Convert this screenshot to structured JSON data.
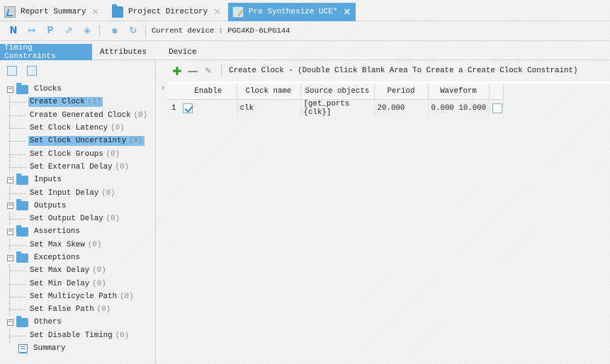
{
  "doc_tabs": [
    {
      "label": "Report Summary",
      "icon": "report-icon",
      "active": false
    },
    {
      "label": "Project Directory",
      "icon": "folder-icon",
      "active": false
    },
    {
      "label": "Pre Synthesize UCE*",
      "icon": "document-icon",
      "active": true
    }
  ],
  "toolbar": {
    "buttons": [
      {
        "glyph": "N",
        "icon": "new-icon"
      },
      {
        "glyph": "↦",
        "icon": "arrow-icon"
      },
      {
        "glyph": "P",
        "icon": "p-icon"
      },
      {
        "glyph": "⬀",
        "icon": "cursor-icon"
      },
      {
        "glyph": "◈",
        "icon": "diamond-icon"
      },
      {
        "glyph": "▪",
        "icon": "save-icon"
      },
      {
        "glyph": "↻",
        "icon": "refresh-icon"
      }
    ],
    "current_device": "Current device : PGC4KD-6LPG144"
  },
  "panel_tabs": [
    "Timing Constraints",
    "Attributes",
    "Device"
  ],
  "tree": [
    {
      "type": "cat",
      "label": "Clocks"
    },
    {
      "type": "leaf",
      "label": "Create Clock",
      "count": "(1)",
      "selected": true
    },
    {
      "type": "leaf",
      "label": "Create Generated Clock",
      "count": "(0)"
    },
    {
      "type": "leaf",
      "label": "Set Clock Latency",
      "count": "(0)"
    },
    {
      "type": "leaf",
      "label": "Set Clock Uncertainty",
      "count": "(0)",
      "selected": true
    },
    {
      "type": "leaf",
      "label": "Set Clock Groups",
      "count": "(0)"
    },
    {
      "type": "leaf",
      "label": "Set External Delay",
      "count": "(0)"
    },
    {
      "type": "cat",
      "label": "Inputs"
    },
    {
      "type": "leaf",
      "label": "Set Input Delay",
      "count": "(0)"
    },
    {
      "type": "cat",
      "label": "Outputs"
    },
    {
      "type": "leaf",
      "label": "Set Output Delay",
      "count": "(0)"
    },
    {
      "type": "cat",
      "label": "Assertions"
    },
    {
      "type": "leaf",
      "label": "Set Max Skew",
      "count": "(0)"
    },
    {
      "type": "cat",
      "label": "Exceptions"
    },
    {
      "type": "leaf",
      "label": "Set Max Delay",
      "count": "(0)"
    },
    {
      "type": "leaf",
      "label": "Set Min Delay",
      "count": "(0)"
    },
    {
      "type": "leaf",
      "label": "Set Multicycle Path",
      "count": "(0)"
    },
    {
      "type": "leaf",
      "label": "Set False Path",
      "count": "(0)"
    },
    {
      "type": "cat",
      "label": "Others"
    },
    {
      "type": "leaf",
      "label": "Set Disable Timing",
      "count": "(0)"
    },
    {
      "type": "summary",
      "label": "Summary"
    }
  ],
  "constraint_title": "Create Clock - (Double Click Blank Area To Create a Create Clock Constraint)",
  "table": {
    "columns": [
      "Enable",
      "Clock name",
      "Source objects",
      "Period",
      "Waveform"
    ],
    "rows": [
      {
        "index": "1",
        "enabled": true,
        "clock_name": "clk",
        "source": "[get_ports {clk}]",
        "period": "20.000",
        "waveform": "0.000 10.000"
      }
    ]
  }
}
